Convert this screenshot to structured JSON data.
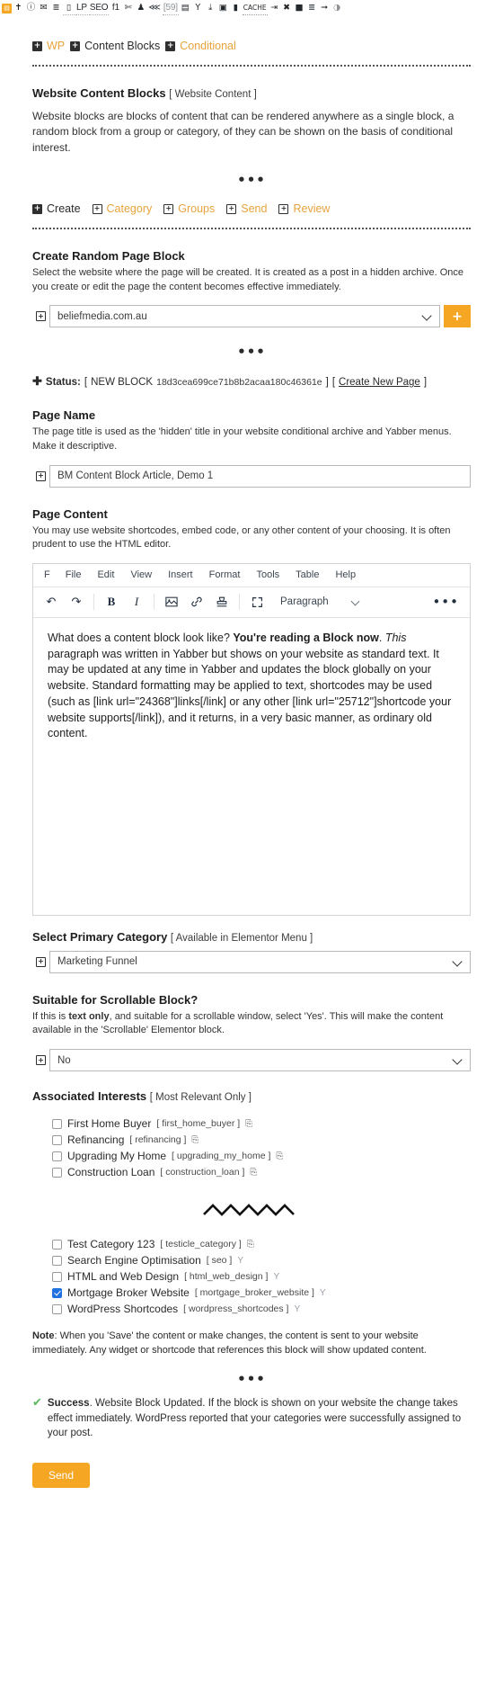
{
  "adminbar": {
    "items": [
      {
        "type": "glyph",
        "label": "wp-logo",
        "icon": "◧",
        "color": "orange"
      },
      {
        "type": "glyph",
        "label": "pin-icon",
        "icon": "†"
      },
      {
        "type": "glyph",
        "label": "info-icon",
        "icon": "ℹ"
      },
      {
        "type": "glyph",
        "label": "mail-icon",
        "icon": "✉"
      },
      {
        "type": "glyph",
        "label": "list-icon",
        "icon": "≡"
      },
      {
        "type": "glyph",
        "label": "chart-icon",
        "icon": "░"
      },
      {
        "type": "text",
        "label": "lp-label",
        "icon": "LP"
      },
      {
        "type": "text",
        "label": "seo-label",
        "icon": "SEO"
      },
      {
        "type": "text",
        "label": "f1-label",
        "icon": "f1"
      },
      {
        "type": "glyph",
        "label": "scissors-icon",
        "icon": "✂"
      },
      {
        "type": "glyph",
        "label": "user-icon",
        "icon": "♟"
      },
      {
        "type": "glyph",
        "label": "share-icon",
        "icon": "⋖"
      },
      {
        "type": "text",
        "label": "comments-count",
        "icon": "[59]"
      },
      {
        "type": "glyph",
        "label": "form-icon",
        "icon": "☰"
      },
      {
        "type": "glyph",
        "label": "filter-icon",
        "icon": "Y"
      },
      {
        "type": "glyph",
        "label": "download-icon",
        "icon": "⤓"
      },
      {
        "type": "glyph",
        "label": "image-icon",
        "icon": "▣"
      },
      {
        "type": "glyph",
        "label": "video-icon",
        "icon": "▶"
      },
      {
        "type": "text",
        "label": "cache-label",
        "icon": "CACHE"
      },
      {
        "type": "glyph",
        "label": "logout-icon",
        "icon": "⇥"
      },
      {
        "type": "glyph",
        "label": "tools-icon",
        "icon": "✖"
      },
      {
        "type": "glyph",
        "label": "save-icon",
        "icon": "■"
      },
      {
        "type": "glyph",
        "label": "menu-icon",
        "icon": "≔"
      },
      {
        "type": "glyph",
        "label": "redo-icon",
        "icon": "↷"
      },
      {
        "type": "glyph",
        "label": "globe-icon",
        "icon": "◑"
      }
    ]
  },
  "breadcrumb": [
    {
      "label": "WP",
      "style": "orange"
    },
    {
      "label": "Content Blocks",
      "style": "dark"
    },
    {
      "label": "Conditional",
      "style": "orange"
    }
  ],
  "intro": {
    "title": "Website Content Blocks",
    "title_suffix": "[ Website Content ]",
    "body": "Website blocks are blocks of content that can be rendered anywhere as a single block, a random block from a group or category, of they can be shown on the basis of conditional interest."
  },
  "divider_dots": "•••",
  "tabs": [
    {
      "label": "Create",
      "style": "dark",
      "icon": "filled"
    },
    {
      "label": "Category",
      "style": "orange",
      "icon": "hollow"
    },
    {
      "label": "Groups",
      "style": "orange",
      "icon": "hollow"
    },
    {
      "label": "Send",
      "style": "orange",
      "icon": "hollow"
    },
    {
      "label": "Review",
      "style": "orange",
      "icon": "hollow"
    }
  ],
  "create_block": {
    "title": "Create Random Page Block",
    "description": "Select the website where the page will be created. It is created as a post in a hidden archive. Once you create or edit the page the content becomes effective immediately.",
    "website_value": "beliefmedia.com.au",
    "add_button": "+"
  },
  "status": {
    "prefix": "Status:",
    "bracket_open": "[",
    "state": "NEW BLOCK",
    "hash": "18d3cea699ce71b8b2acaa180c46361e",
    "bracket_close": "]",
    "action_open": "[",
    "action": "Create New Page",
    "action_close": "]"
  },
  "page_name": {
    "title": "Page Name",
    "description": "The page title is used as the 'hidden' title in your website conditional archive and Yabber menus. Make it descriptive.",
    "value": "BM Content Block Article, Demo 1"
  },
  "page_content": {
    "title": "Page Content",
    "description": "You may use website shortcodes, embed code, or any other content of your choosing. It is often prudent to use the HTML editor.",
    "menubar": [
      "F",
      "File",
      "Edit",
      "View",
      "Insert",
      "Format",
      "Tools",
      "Table",
      "Help"
    ],
    "toolbar": {
      "undo": "↶",
      "redo": "↷",
      "bold": "B",
      "italic": "I",
      "image": "⛰",
      "link": "ὑ7",
      "stamp": "⚓",
      "fullscreen": "⤡",
      "format_label": "Paragraph",
      "more": "•••"
    },
    "body_html": "What does a content block look like? <b>You're reading a Block now</b>. <i>This</i> paragraph was written in Yabber but shows on your website as standard text. It may be updated at any time in Yabber and updates the block globally on your website. Standard formatting may be applied to text, shortcodes may be used (such as [link url=\"24368\"]links[/link] or any other [link url=\"25712\"]shortcode your website supports[/link]), and it returns, in a very basic manner, as ordinary old content."
  },
  "primary_category": {
    "title": "Select Primary Category",
    "title_suffix": "[ Available in Elementor Menu ]",
    "value": "Marketing Funnel"
  },
  "scrollable": {
    "title": "Suitable for Scrollable Block?",
    "description_pre": "If this is ",
    "description_bold": "text only",
    "description_post": ", and suitable for a scrollable window, select 'Yes'. This will make the content available in the 'Scrollable' Elementor block.",
    "value": "No"
  },
  "interests": {
    "title": "Associated Interests",
    "title_suffix": "[ Most Relevant Only ]",
    "items": [
      {
        "label": "First Home Buyer",
        "slug": "[ first_home_buyer ]",
        "checked": false,
        "glyph": "✇"
      },
      {
        "label": "Refinancing",
        "slug": "[ refinancing ]",
        "checked": false,
        "glyph": "✇"
      },
      {
        "label": "Upgrading My Home",
        "slug": "[ upgrading_my_home ]",
        "checked": false,
        "glyph": "✇"
      },
      {
        "label": "Construction Loan",
        "slug": "[ construction_loan ]",
        "checked": false,
        "glyph": "✇"
      }
    ]
  },
  "categories": {
    "items": [
      {
        "label": "Test Category 123",
        "slug": "[ testicle_category ]",
        "checked": false,
        "glyph": "✇",
        "glyph_type": "icon"
      },
      {
        "label": "Search Engine Optimisation",
        "slug": "[ seo ]",
        "checked": false,
        "glyph": "Y",
        "glyph_type": "y"
      },
      {
        "label": "HTML and Web Design",
        "slug": "[ html_web_design ]",
        "checked": false,
        "glyph": "Y",
        "glyph_type": "y"
      },
      {
        "label": "Mortgage Broker Website",
        "slug": "[ mortgage_broker_website ]",
        "checked": true,
        "glyph": "Y",
        "glyph_type": "y"
      },
      {
        "label": "WordPress Shortcodes",
        "slug": "[ wordpress_shortcodes ]",
        "checked": false,
        "glyph": "Y",
        "glyph_type": "y"
      }
    ]
  },
  "note": {
    "label": "Note",
    "text": ": When you 'Save' the content or make changes, the content is sent to your website immediately. Any widget or shortcode that references this block will show updated content."
  },
  "success": {
    "tick": "✔",
    "label": "Success",
    "text": ". Website Block Updated. If the block is shown on your website the change takes effect immediately. WordPress reported that your categories were successfully assigned to your post."
  },
  "send_button": "Send",
  "colors": {
    "accent": "#f5a623",
    "link_orange": "#e8a33d",
    "checkbox_blue": "#2271e0",
    "success_green": "#5cb85c"
  }
}
